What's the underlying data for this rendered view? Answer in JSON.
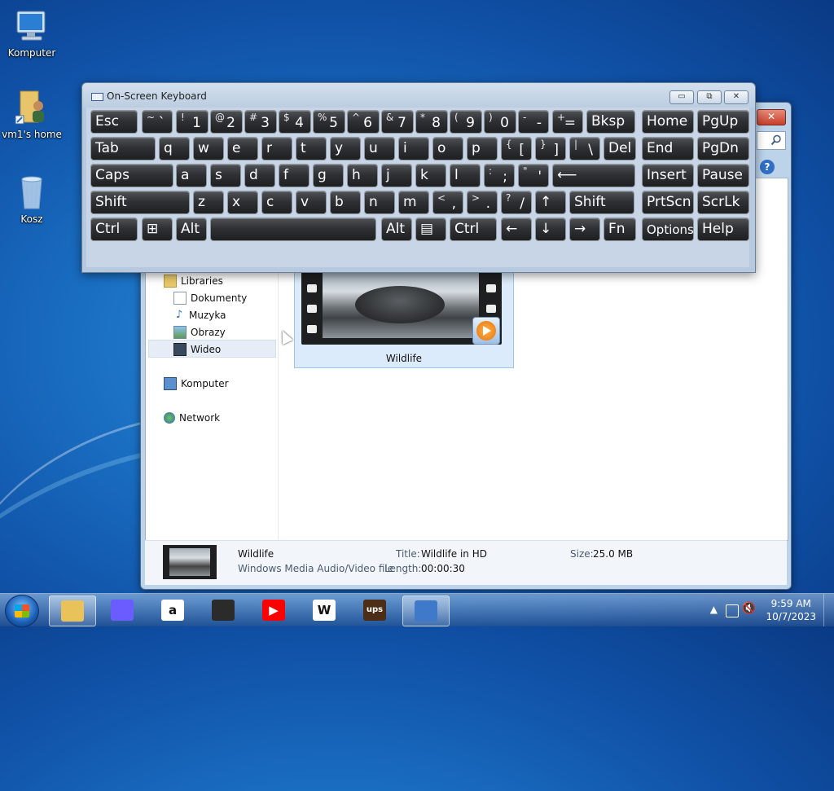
{
  "desktop": {
    "icons": [
      {
        "label": "Komputer"
      },
      {
        "label": "vm1's home"
      },
      {
        "label": "Kosz"
      }
    ]
  },
  "explorer": {
    "close_label": "✕",
    "help_label": "?",
    "nav": {
      "libraries": "Libraries",
      "dokumenty": "Dokumenty",
      "muzyka": "Muzyka",
      "obrazy": "Obrazy",
      "wideo": "Wideo",
      "komputer": "Komputer",
      "network": "Network"
    },
    "file": {
      "name": "Wildlife"
    },
    "details": {
      "name": "Wildlife",
      "type": "Windows Media Audio/Video file",
      "title_label": "Title:",
      "title_value": "Wildlife in HD",
      "length_label": "Length:",
      "length_value": "00:00:30",
      "size_label": "Size:",
      "size_value": "25.0 MB"
    }
  },
  "osk": {
    "title": "On-Screen Keyboard",
    "minimize": "▭",
    "restore": "⧉",
    "close": "✕",
    "rows": [
      [
        {
          "t": "Esc"
        },
        {
          "s": "~",
          "b": "`"
        },
        {
          "s": "!",
          "b": "1"
        },
        {
          "s": "@",
          "b": "2"
        },
        {
          "s": "#",
          "b": "3"
        },
        {
          "s": "$",
          "b": "4"
        },
        {
          "s": "%",
          "b": "5"
        },
        {
          "s": "^",
          "b": "6"
        },
        {
          "s": "&",
          "b": "7"
        },
        {
          "s": "*",
          "b": "8"
        },
        {
          "s": "(",
          "b": "9"
        },
        {
          "s": ")",
          "b": "0"
        },
        {
          "s": "-",
          "b": "-"
        },
        {
          "s": "+",
          "b": "="
        },
        {
          "t": "Bksp"
        },
        {
          "t": "Home"
        },
        {
          "t": "PgUp"
        }
      ],
      [
        {
          "t": "Tab"
        },
        {
          "t": "q"
        },
        {
          "t": "w"
        },
        {
          "t": "e"
        },
        {
          "t": "r"
        },
        {
          "t": "t"
        },
        {
          "t": "y"
        },
        {
          "t": "u"
        },
        {
          "t": "i"
        },
        {
          "t": "o"
        },
        {
          "t": "p"
        },
        {
          "s": "{",
          "b": "["
        },
        {
          "s": "}",
          "b": "]"
        },
        {
          "s": "|",
          "b": "\\"
        },
        {
          "t": "Del"
        },
        {
          "t": "End"
        },
        {
          "t": "PgDn"
        }
      ],
      [
        {
          "t": "Caps"
        },
        {
          "t": "a"
        },
        {
          "t": "s"
        },
        {
          "t": "d"
        },
        {
          "t": "f"
        },
        {
          "t": "g"
        },
        {
          "t": "h"
        },
        {
          "t": "j"
        },
        {
          "t": "k"
        },
        {
          "t": "l"
        },
        {
          "s": ":",
          "b": ";"
        },
        {
          "s": "\"",
          "b": "'"
        },
        {
          "t": "⟵"
        },
        {
          "t": "Insert"
        },
        {
          "t": "Pause"
        }
      ],
      [
        {
          "t": "Shift"
        },
        {
          "t": "z"
        },
        {
          "t": "x"
        },
        {
          "t": "c"
        },
        {
          "t": "v"
        },
        {
          "t": "b"
        },
        {
          "t": "n"
        },
        {
          "t": "m"
        },
        {
          "s": "<",
          "b": ","
        },
        {
          "s": ">",
          "b": "."
        },
        {
          "s": "?",
          "b": "/"
        },
        {
          "t": "↑"
        },
        {
          "t": "Shift"
        },
        {
          "t": "PrtScn"
        },
        {
          "t": "ScrLk"
        }
      ],
      [
        {
          "t": "Ctrl"
        },
        {
          "t": "⊞"
        },
        {
          "t": "Alt"
        },
        {
          "t": ""
        },
        {
          "t": "Alt"
        },
        {
          "t": "▤"
        },
        {
          "t": "Ctrl"
        },
        {
          "t": "←"
        },
        {
          "t": "↓"
        },
        {
          "t": "→"
        },
        {
          "t": "Fn"
        },
        {
          "t": "Options"
        },
        {
          "t": "Help"
        }
      ]
    ]
  },
  "taskbar": {
    "clock_time": "9:59 AM",
    "clock_date": "10/7/2023",
    "tray_arrow": "▲",
    "apps": [
      {
        "name": "explorer",
        "glyph": "",
        "color": "#e9c35a"
      },
      {
        "name": "copilot",
        "glyph": "",
        "color": "#6a5cff"
      },
      {
        "name": "amazon",
        "glyph": "a",
        "color": "#ffffff"
      },
      {
        "name": "store",
        "glyph": "",
        "color": "#2b2b2b"
      },
      {
        "name": "youtube",
        "glyph": "▶",
        "color": "#ff0000"
      },
      {
        "name": "wikipedia",
        "glyph": "W",
        "color": "#ffffff"
      },
      {
        "name": "ups",
        "glyph": "ups",
        "color": "#4b2e15"
      },
      {
        "name": "osk",
        "glyph": "",
        "color": "#3f79c9"
      }
    ]
  }
}
